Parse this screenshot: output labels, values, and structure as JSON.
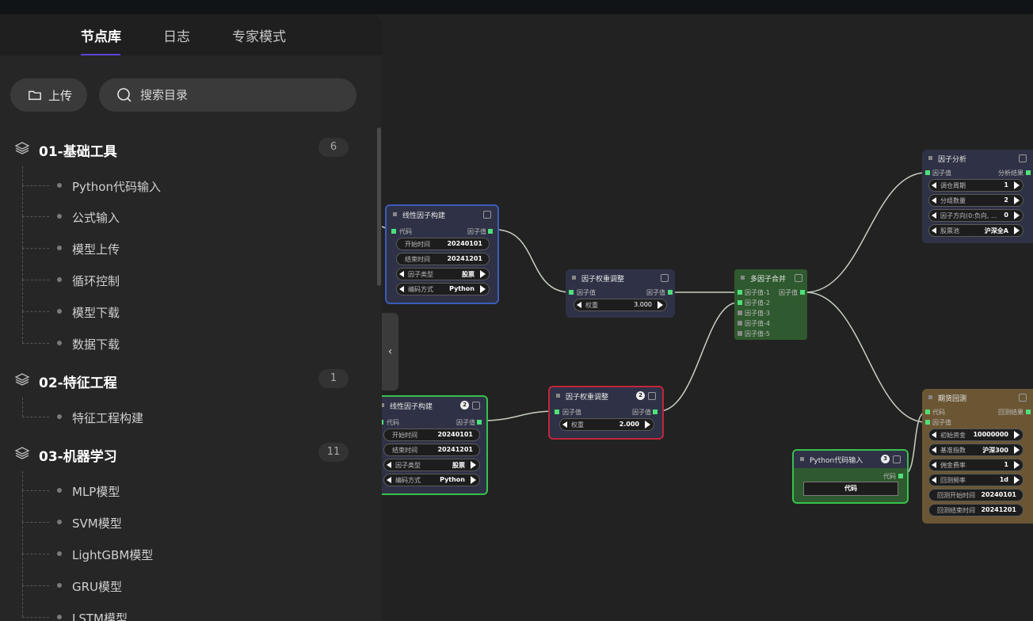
{
  "tabs": [
    {
      "label": "节点库",
      "active": true
    },
    {
      "label": "日志",
      "active": false
    },
    {
      "label": "专家模式",
      "active": false
    }
  ],
  "upload_label": "上传",
  "search_placeholder": "搜索目录",
  "categories": [
    {
      "name": "01-基础工具",
      "count": "6",
      "items": [
        "Python代码输入",
        "公式输入",
        "模型上传",
        "循环控制",
        "模型下载",
        "数据下载"
      ]
    },
    {
      "name": "02-特征工程",
      "count": "1",
      "items": [
        "特征工程构建"
      ]
    },
    {
      "name": "03-机器学习",
      "count": "11",
      "items": [
        "MLP模型",
        "SVM模型",
        "LightGBM模型",
        "GRU模型",
        "LSTM模型"
      ]
    }
  ],
  "colors": {
    "accent": "#5b46d6",
    "port": "#4fe07a",
    "wire": "#c7cfc2"
  },
  "nodes": {
    "lf1": {
      "title": "线性因子构建",
      "in": "代码",
      "out": "因子值",
      "rows": [
        {
          "label": "开始时间",
          "value": "20240101"
        },
        {
          "label": "结束时间",
          "value": "20241201"
        },
        {
          "label": "因子类型",
          "value": "股票"
        },
        {
          "label": "编码方式",
          "value": "Python"
        }
      ]
    },
    "lf2": {
      "title": "线性因子构建",
      "badge": "2",
      "in": "代码",
      "out": "因子值",
      "rows": [
        {
          "label": "开始时间",
          "value": "20240101"
        },
        {
          "label": "结束时间",
          "value": "20241201"
        },
        {
          "label": "因子类型",
          "value": "股票"
        },
        {
          "label": "编码方式",
          "value": "Python"
        }
      ]
    },
    "w1": {
      "title": "因子权重调整",
      "in": "因子值",
      "out": "因子值",
      "row": {
        "label": "权重",
        "value": "3.000"
      }
    },
    "w2": {
      "title": "因子权重调整",
      "badge": "2",
      "in": "因子值",
      "out": "因子值",
      "row": {
        "label": "权重",
        "value": "2.000"
      }
    },
    "merge": {
      "title": "多因子合并",
      "out": "因子值",
      "inputs": [
        "因子值-1",
        "因子值-2",
        "因子值-3",
        "因子值-4",
        "因子值-5"
      ]
    },
    "analysis": {
      "title": "因子分析",
      "in": "因子值",
      "out": "分析结果",
      "rows": [
        {
          "label": "调仓周期",
          "value": "1"
        },
        {
          "label": "分组数量",
          "value": "2"
        },
        {
          "label": "因子方向(0:负向, ...",
          "value": "0"
        },
        {
          "label": "股票池",
          "value": "沪深全A"
        }
      ]
    },
    "py": {
      "title": "Python代码输入",
      "badge": "3",
      "out": "代码",
      "field": "代码"
    },
    "backtest": {
      "title": "期货回测",
      "in1": "代码",
      "in2": "因子值",
      "out": "回测结果",
      "rows": [
        {
          "label": "初始资金",
          "value": "10000000"
        },
        {
          "label": "基准指数",
          "value": "沪深300"
        },
        {
          "label": "佣金费率",
          "value": "1"
        },
        {
          "label": "回测频率",
          "value": "1d"
        },
        {
          "label": "回测开始时间",
          "value": "20240101"
        },
        {
          "label": "回测结束时间",
          "value": "20241201"
        }
      ]
    }
  }
}
